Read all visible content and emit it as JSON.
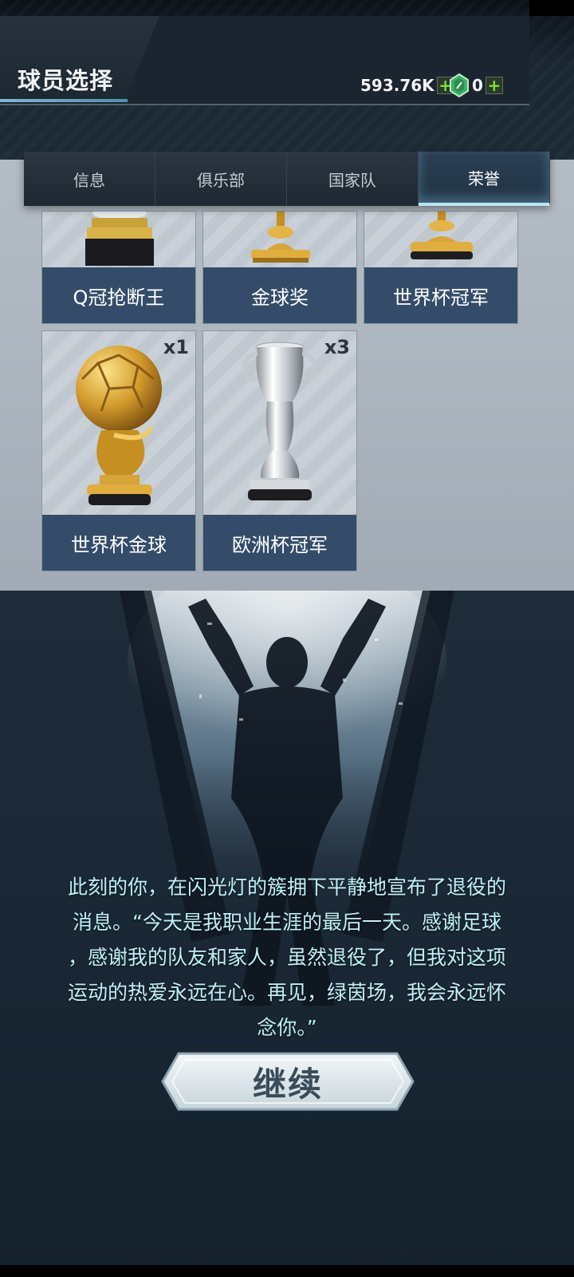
{
  "header": {
    "title": "球员选择",
    "coins": "593.76K",
    "gems": "0",
    "coins_plus": "+",
    "gems_plus": "+"
  },
  "tabs": [
    {
      "label": "信息",
      "active": false
    },
    {
      "label": "俱乐部",
      "active": false
    },
    {
      "label": "国家队",
      "active": false
    },
    {
      "label": "荣誉",
      "active": true
    }
  ],
  "honors": [
    {
      "label": "Q冠抢断王",
      "count": "",
      "icon": "trophy-black-base-icon"
    },
    {
      "label": "金球奖",
      "count": "",
      "icon": "gold-cup-icon"
    },
    {
      "label": "世界杯冠军",
      "count": "",
      "icon": "gold-cup-icon"
    },
    {
      "label": "世界杯金球",
      "count": "x1",
      "icon": "golden-ball-trophy-icon"
    },
    {
      "label": "欧洲杯冠军",
      "count": "x3",
      "icon": "silver-cup-icon"
    }
  ],
  "story": {
    "lines": [
      "此刻的你，在闪光灯的簇拥下平静地宣布了退役的",
      "消息。“今天是我职业生涯的最后一天。感谢足球",
      "，感谢我的队友和家人，虽然退役了，但我对这项",
      "运动的热爱永远在心。再见，绿茵场，我会永远怀",
      "念你。”"
    ]
  },
  "continue_label": "继续",
  "colors": {
    "label_bg": "#344c69",
    "accent": "#b9e6f2",
    "story_text": "#bff0f6",
    "plus_green": "#7ee23a"
  }
}
